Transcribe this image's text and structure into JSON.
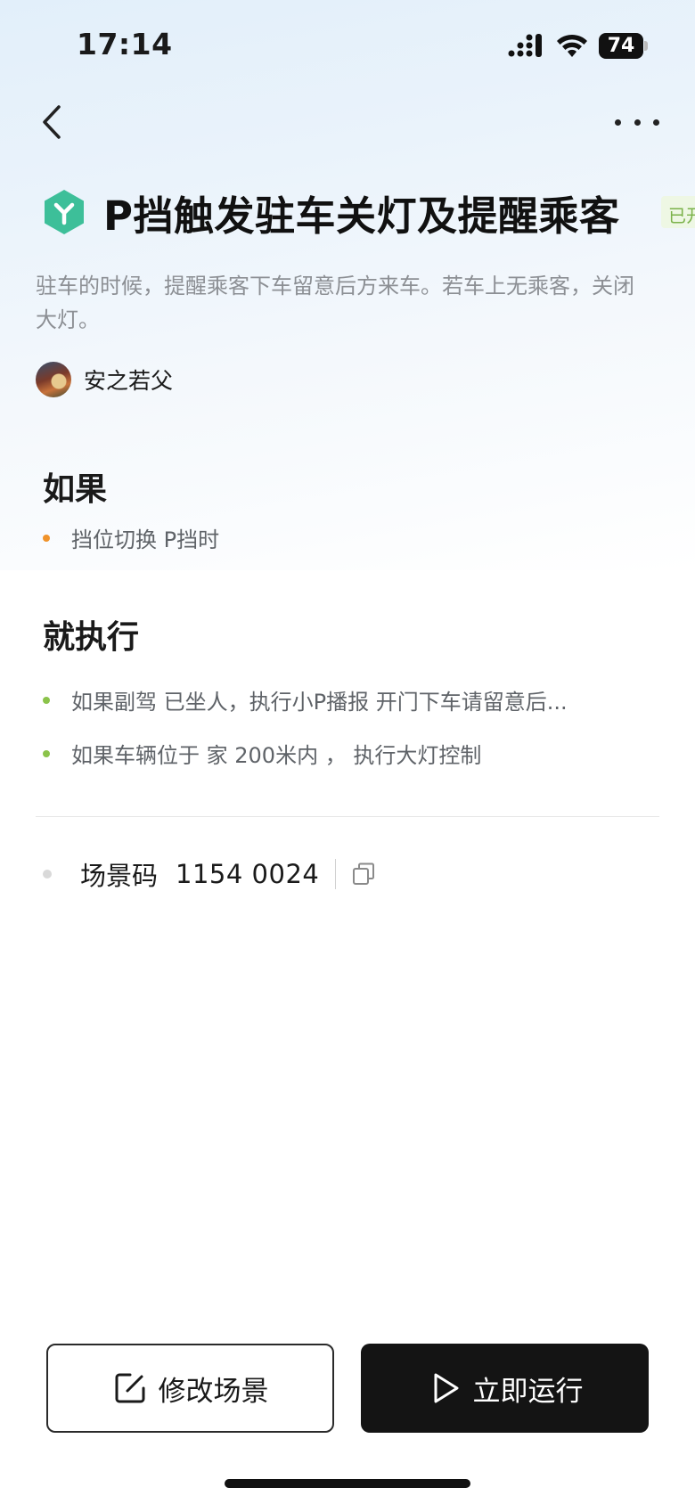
{
  "status_bar": {
    "time": "17:14",
    "battery_level": "74"
  },
  "nav": {
    "back_icon": "chevron-left-icon",
    "more_icon": "more-horizontal-icon"
  },
  "scene": {
    "icon": "hexagon-scene-icon",
    "icon_color": "#3dbf99",
    "title": "P挡触发驻车关灯及提醒乘客",
    "status_tag": "已开",
    "description": "驻车的时候，提醒乘客下车留意后方来车。若车上无乘客，关闭大灯。",
    "author": {
      "name": "安之若父"
    }
  },
  "if_section": {
    "title": "如果",
    "conditions": [
      "挡位切换 P挡时"
    ]
  },
  "then_section": {
    "title": "就执行",
    "actions": [
      "如果副驾  已坐人，执行小P播报 开门下车请留意后...",
      "如果车辆位于 家 200米内 ， 执行大灯控制"
    ]
  },
  "scene_code": {
    "label": "场景码",
    "value": "1154 0024",
    "copy_icon": "copy-icon"
  },
  "actions": {
    "edit_label": "修改场景",
    "edit_icon": "edit-icon",
    "run_label": "立即运行",
    "run_icon": "play-icon"
  },
  "colors": {
    "accent_green": "#8bc34a",
    "accent_orange": "#f0932b",
    "run_button_bg": "#141414"
  }
}
